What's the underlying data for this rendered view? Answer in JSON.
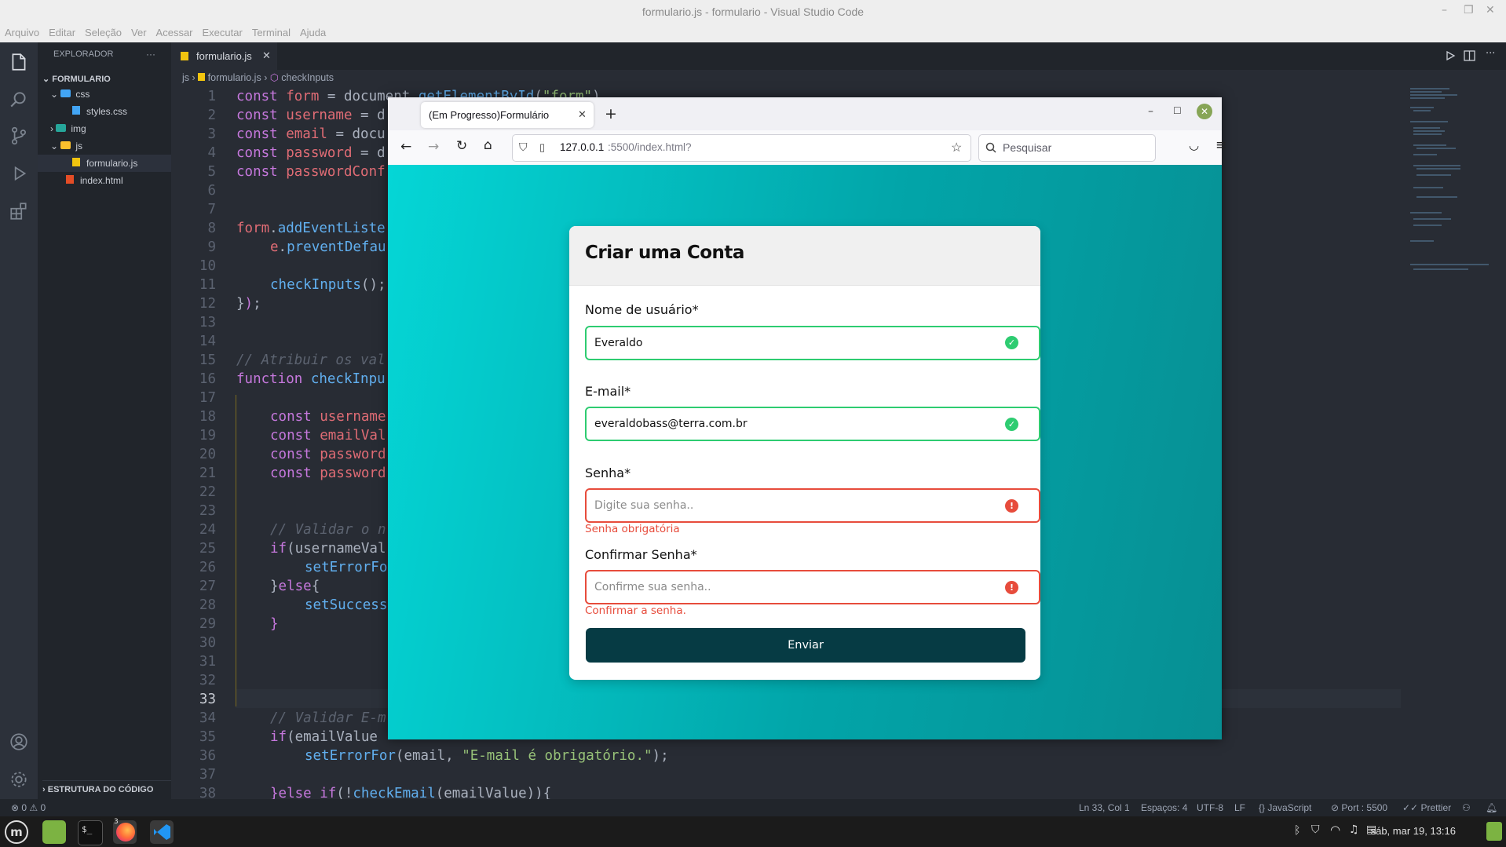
{
  "window_title": "formulario.js - formulario - Visual Studio Code",
  "menu": [
    "Arquivo",
    "Editar",
    "Seleção",
    "Ver",
    "Acessar",
    "Executar",
    "Terminal",
    "Ajuda"
  ],
  "sidebar": {
    "header": "EXPLORADOR",
    "more": "···",
    "root": "FORMULARIO",
    "items": [
      {
        "label": "css",
        "kind": "folder"
      },
      {
        "label": "styles.css",
        "kind": "css"
      },
      {
        "label": "img",
        "kind": "folder"
      },
      {
        "label": "js",
        "kind": "folder"
      },
      {
        "label": "formulario.js",
        "kind": "js"
      },
      {
        "label": "index.html",
        "kind": "html"
      }
    ],
    "outline": "ESTRUTURA DO CÓDIGO"
  },
  "editor": {
    "tab_label": "formulario.js",
    "breadcrumb": [
      "js",
      "formulario.js",
      "checkInputs"
    ],
    "line_numbers": [
      "1",
      "2",
      "3",
      "4",
      "5",
      "6",
      "7",
      "8",
      "9",
      "10",
      "11",
      "12",
      "13",
      "14",
      "15",
      "16",
      "17",
      "18",
      "19",
      "20",
      "21",
      "22",
      "23",
      "24",
      "25",
      "26",
      "27",
      "28",
      "29",
      "30",
      "31",
      "32",
      "33",
      "34",
      "35",
      "36",
      "37",
      "38"
    ],
    "visible_code": {
      "l1": "const form = document.getElementById(\"form\")",
      "l2": "const username = d",
      "l3": "const email = docu",
      "l4": "const password = d",
      "l5": "const passwordConf",
      "l8": "form.addEventListe",
      "l9": "e.preventDefau",
      "l11": "checkInputs();",
      "l12": "});",
      "l15": "// Atribuir os val",
      "l16": "function checkInpu",
      "l18": "const username",
      "l19": "const emailVal",
      "l20": "const password",
      "l21": "const password",
      "l24": "// Validar o n",
      "l25": "if(usernameVal",
      "l26": "setErrorFo",
      "l27": "}else{",
      "l28": "setSuccess",
      "l29": "}",
      "l34": "// Validar E-m",
      "l35": "if(emailValue",
      "l36": "setErrorFor(email, \"E-mail é obrigatório.\");",
      "l38": "}else if(!checkEmail(emailValue)){"
    }
  },
  "statusbar": {
    "problems": "⊗ 0 ⚠ 0",
    "position": "Ln 33, Col 1",
    "spaces": "Espaços: 4",
    "encoding": "UTF-8",
    "eol": "LF",
    "language": "{} JavaScript",
    "port": "⊘ Port : 5500",
    "prettier": "✓✓ Prettier"
  },
  "taskbar": {
    "clock": "sáb, mar 19, 13:16",
    "firefox_badge": "3"
  },
  "browser": {
    "tab_title": "(Em Progresso)Formulário",
    "url_host": "127.0.0.1",
    "url_path": ":5500/index.html?",
    "search_placeholder": "Pesquisar"
  },
  "form": {
    "title": "Criar uma Conta",
    "username": {
      "label": "Nome de usuário*",
      "value": "Everaldo",
      "status": "success"
    },
    "email": {
      "label": "E-mail*",
      "value": "everaldobass@terra.com.br",
      "status": "success"
    },
    "password": {
      "label": "Senha*",
      "placeholder": "Digite sua senha..",
      "error": "Senha obrigatória",
      "status": "error"
    },
    "password_confirmation": {
      "label": "Confirmar Senha*",
      "placeholder": "Confirme sua senha..",
      "error": "Confirmar a senha.",
      "status": "error"
    },
    "submit": "Enviar"
  },
  "colors": {
    "success": "#2ecc71",
    "error": "#e74c3c",
    "button": "#063b44",
    "bg_gradient_start": "#05d6d6",
    "bg_gradient_end": "#078f93"
  }
}
